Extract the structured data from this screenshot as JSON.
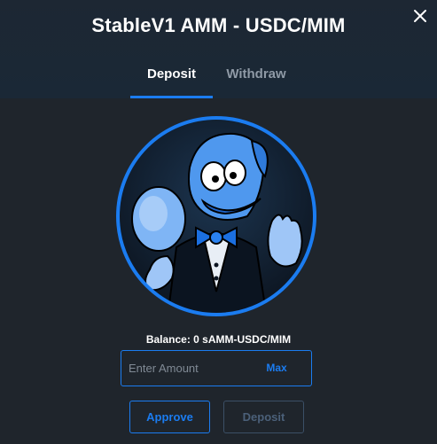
{
  "modal": {
    "title": "StableV1 AMM - USDC/MIM",
    "close_icon": "close-icon"
  },
  "tabs": [
    {
      "label": "Deposit",
      "active": true
    },
    {
      "label": "Withdraw",
      "active": false
    }
  ],
  "hero": {
    "icon": "cartoon-mascot-avatar"
  },
  "balance": {
    "text": "Balance: 0 sAMM-USDC/MIM"
  },
  "amount": {
    "placeholder": "Enter Amount",
    "value": "",
    "max_label": "Max"
  },
  "actions": {
    "approve_label": "Approve",
    "deposit_label": "Deposit",
    "deposit_enabled": false
  },
  "colors": {
    "accent": "#1b7cf0",
    "background": "#1f252c",
    "header": "#1b2734",
    "muted": "#8f9aa6"
  }
}
